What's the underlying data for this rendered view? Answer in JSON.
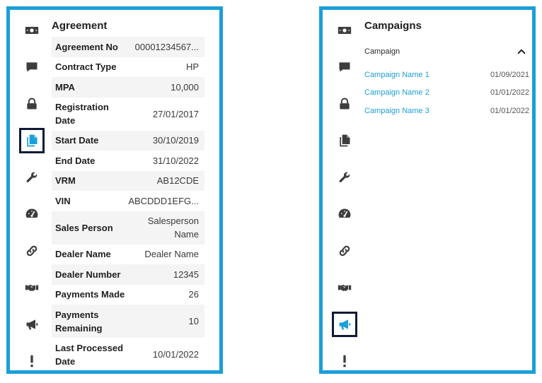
{
  "colors": {
    "accent": "#1a9fd9",
    "active_border": "#0f1b33",
    "icon": "#3d3d3d"
  },
  "agreement_panel": {
    "title": "Agreement",
    "rail": [
      {
        "icon": "money-icon"
      },
      {
        "icon": "chat-icon"
      },
      {
        "icon": "lock-icon"
      },
      {
        "icon": "documents-icon",
        "active": true
      },
      {
        "icon": "wrench-icon"
      },
      {
        "icon": "speedometer-icon"
      },
      {
        "icon": "link-icon"
      },
      {
        "icon": "handshake-icon"
      },
      {
        "icon": "megaphone-icon"
      },
      {
        "icon": "exclamation-icon"
      }
    ],
    "rows": [
      {
        "label": "Agreement No",
        "value": "00001234567..."
      },
      {
        "label": "Contract Type",
        "value": "HP"
      },
      {
        "label": "MPA",
        "value": "10,000"
      },
      {
        "label": "Registration Date",
        "value": "27/01/2017"
      },
      {
        "label": "Start Date",
        "value": "30/10/2019"
      },
      {
        "label": "End Date",
        "value": "31/10/2022"
      },
      {
        "label": "VRM",
        "value": "AB12CDE"
      },
      {
        "label": "VIN",
        "value": "ABCDDD1EFG..."
      },
      {
        "label": "Sales Person",
        "value": "Salesperson Name"
      },
      {
        "label": "Dealer Name",
        "value": "Dealer Name"
      },
      {
        "label": "Dealer Number",
        "value": "12345"
      },
      {
        "label": "Payments Made",
        "value": "26"
      },
      {
        "label": "Payments Remaining",
        "value": "10"
      },
      {
        "label": "Last Processed Date",
        "value": "10/01/2022"
      }
    ]
  },
  "campaigns_panel": {
    "title": "Campaigns",
    "section_label": "Campaign",
    "expanded": true,
    "rail": [
      {
        "icon": "money-icon"
      },
      {
        "icon": "chat-icon"
      },
      {
        "icon": "lock-icon"
      },
      {
        "icon": "documents-icon"
      },
      {
        "icon": "wrench-icon"
      },
      {
        "icon": "speedometer-icon"
      },
      {
        "icon": "link-icon"
      },
      {
        "icon": "handshake-icon"
      },
      {
        "icon": "megaphone-icon",
        "active": true
      },
      {
        "icon": "exclamation-icon"
      }
    ],
    "items": [
      {
        "name": "Campaign Name 1",
        "date": "01/09/2021"
      },
      {
        "name": "Campaign Name 2",
        "date": "01/01/2022"
      },
      {
        "name": "Campaign Name 3",
        "date": "01/01/2022"
      }
    ]
  }
}
